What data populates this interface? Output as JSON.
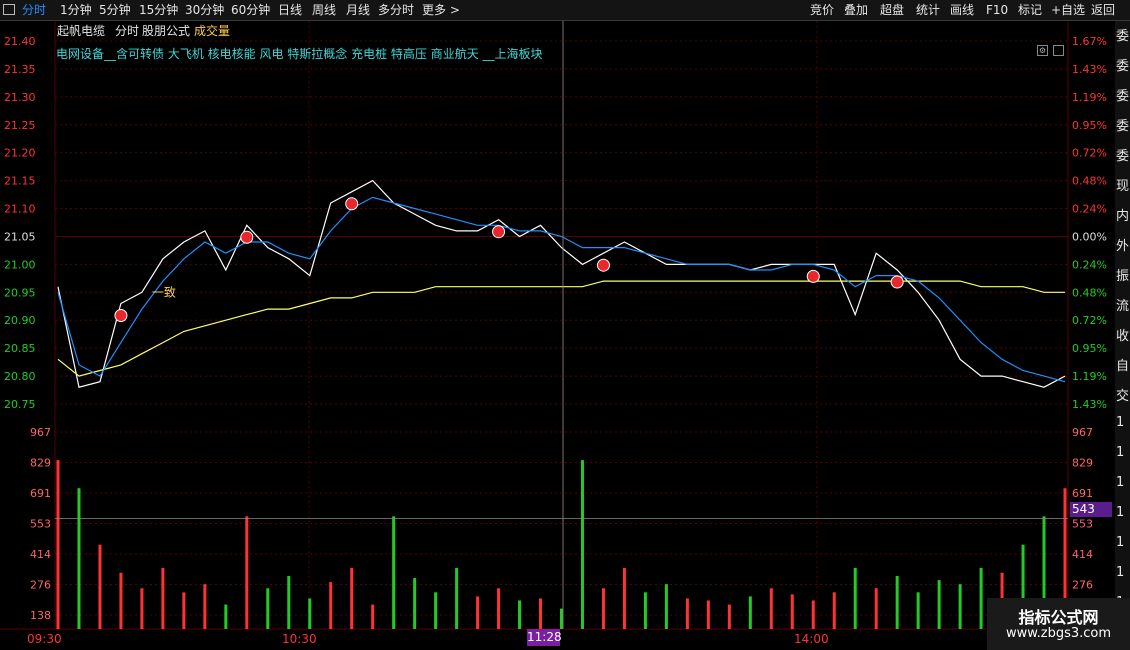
{
  "toolbar": {
    "periods": [
      "分时",
      "1分钟",
      "5分钟",
      "15分钟",
      "30分钟",
      "60分钟",
      "日线",
      "周线",
      "月线",
      "多分时",
      "更多 >"
    ],
    "actions": [
      "竞价",
      "叠加",
      "超盘",
      "统计",
      "画线",
      "F10",
      "标记",
      "+自选",
      "返回"
    ]
  },
  "subheader": {
    "stock_name": "起帆电缆",
    "view": "分时",
    "formula": "股朋公式",
    "volume_label": "成交量"
  },
  "concept_tags": "电网设备__含可转债 大飞机 核电核能 风电 特斯拉概念 充电桩 特高压 商业航天 __上海板块",
  "price_axis": {
    "left": [
      "21.40",
      "21.35",
      "21.30",
      "21.25",
      "21.20",
      "21.15",
      "21.10",
      "21.05",
      "21.00",
      "20.95",
      "20.90",
      "20.85",
      "20.80",
      "20.75"
    ],
    "right": [
      "1.67%",
      "1.43%",
      "1.19%",
      "0.95%",
      "0.72%",
      "0.48%",
      "0.24%",
      "0.00%",
      "0.24%",
      "0.48%",
      "0.72%",
      "0.95%",
      "1.19%",
      "1.43%"
    ]
  },
  "volume_axis": [
    "967",
    "829",
    "691",
    "553",
    "414",
    "276",
    "138"
  ],
  "volume_badge": "543",
  "time_axis": [
    "09:30",
    "10:30",
    "14:00"
  ],
  "time_badge": "11:28",
  "signal_labels": [
    "一致"
  ],
  "right_strip": [
    "委",
    "委",
    "委",
    "委",
    "委",
    "现",
    "内",
    "外",
    "振",
    "流",
    "收",
    "自",
    "交",
    "1",
    "1",
    "1",
    "1",
    "1",
    "1",
    "1"
  ],
  "watermark": {
    "title": "指标公式网",
    "url": "www.zbgs3.com"
  },
  "colors": {
    "price_line": "#ffffff",
    "avg_line": "#ffff66",
    "ma_blue": "#1e90ff",
    "ma_cyan": "#4fc3f7",
    "red_dash": "#ff2020",
    "green_dash": "#22cc22",
    "axis_up": "#ff3333",
    "axis_down": "#22cc22",
    "grid": "#5a0000"
  },
  "chart_data": {
    "type": "line",
    "x": [
      "09:30",
      "09:35",
      "09:40",
      "09:45",
      "09:50",
      "09:55",
      "10:00",
      "10:05",
      "10:10",
      "10:15",
      "10:20",
      "10:25",
      "10:30",
      "10:35",
      "10:40",
      "10:45",
      "10:50",
      "10:55",
      "11:00",
      "11:05",
      "11:10",
      "11:15",
      "11:20",
      "11:25",
      "11:30",
      "13:05",
      "13:10",
      "13:15",
      "13:20",
      "13:25",
      "13:30",
      "13:35",
      "13:40",
      "13:45",
      "13:50",
      "13:55",
      "14:00",
      "14:05",
      "14:10",
      "14:15",
      "14:20",
      "14:25",
      "14:30",
      "14:35",
      "14:40",
      "14:45",
      "14:50",
      "14:55",
      "15:00"
    ],
    "series": [
      {
        "name": "price",
        "values": [
          20.96,
          20.78,
          20.79,
          20.93,
          20.95,
          21.01,
          21.04,
          21.06,
          20.99,
          21.07,
          21.03,
          21.01,
          20.98,
          21.11,
          21.13,
          21.15,
          21.11,
          21.09,
          21.07,
          21.06,
          21.06,
          21.08,
          21.05,
          21.07,
          21.03,
          21.0,
          21.02,
          21.04,
          21.02,
          21.0,
          21.0,
          21.0,
          21.0,
          20.99,
          21.0,
          21.0,
          21.0,
          21.0,
          20.91,
          21.02,
          20.99,
          20.95,
          20.9,
          20.83,
          20.8,
          20.8,
          20.79,
          20.78,
          20.8
        ]
      },
      {
        "name": "avg",
        "values": [
          20.83,
          20.8,
          20.81,
          20.82,
          20.84,
          20.86,
          20.88,
          20.89,
          20.9,
          20.91,
          20.92,
          20.92,
          20.93,
          20.94,
          20.94,
          20.95,
          20.95,
          20.95,
          20.96,
          20.96,
          20.96,
          20.96,
          20.96,
          20.96,
          20.96,
          20.96,
          20.97,
          20.97,
          20.97,
          20.97,
          20.97,
          20.97,
          20.97,
          20.97,
          20.97,
          20.97,
          20.97,
          20.97,
          20.97,
          20.97,
          20.97,
          20.97,
          20.97,
          20.97,
          20.96,
          20.96,
          20.96,
          20.95,
          20.95
        ]
      },
      {
        "name": "ma_blue",
        "values": [
          20.95,
          20.82,
          20.8,
          20.86,
          20.92,
          20.97,
          21.01,
          21.04,
          21.02,
          21.04,
          21.04,
          21.02,
          21.01,
          21.06,
          21.1,
          21.12,
          21.11,
          21.1,
          21.09,
          21.08,
          21.07,
          21.07,
          21.06,
          21.06,
          21.05,
          21.03,
          21.03,
          21.03,
          21.02,
          21.01,
          21.0,
          21.0,
          21.0,
          20.99,
          20.99,
          21.0,
          21.0,
          20.99,
          20.96,
          20.98,
          20.98,
          20.97,
          20.94,
          20.9,
          20.86,
          20.83,
          20.81,
          20.8,
          20.79
        ]
      }
    ],
    "volume": [
      829,
      691,
      414,
      276,
      200,
      300,
      180,
      220,
      120,
      553,
      200,
      260,
      150,
      230,
      300,
      120,
      553,
      250,
      180,
      300,
      160,
      200,
      140,
      150,
      100,
      829,
      200,
      300,
      180,
      220,
      150,
      140,
      120,
      160,
      200,
      170,
      140,
      180,
      300,
      200,
      260,
      180,
      240,
      220,
      300,
      276,
      414,
      553,
      691
    ],
    "ylim": [
      20.75,
      21.4
    ],
    "volume_max": 967
  }
}
